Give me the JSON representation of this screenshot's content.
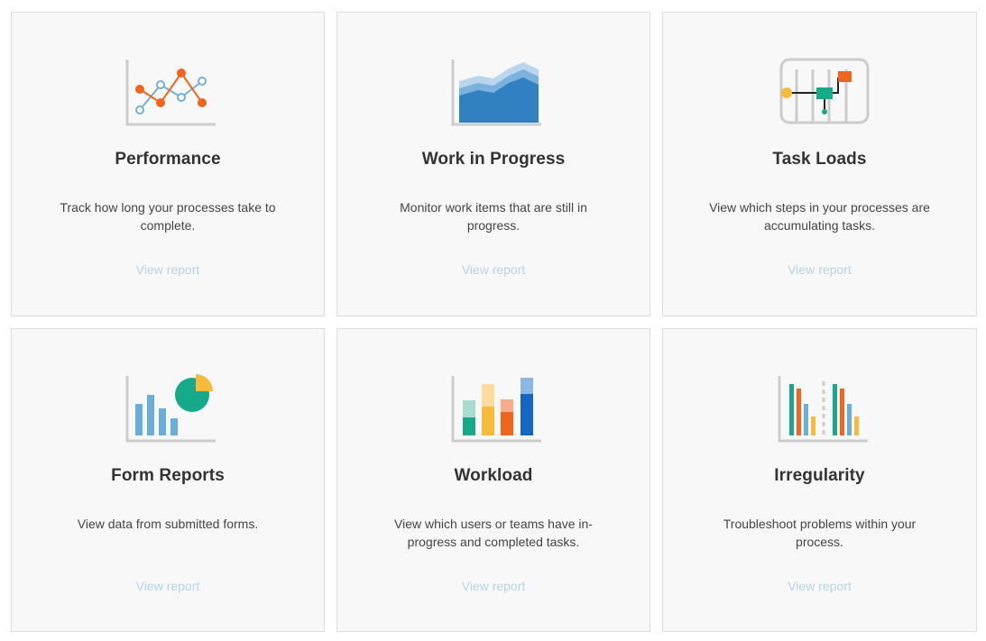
{
  "link_color": "#b7d3e9",
  "cards": [
    {
      "title": "Performance",
      "description": "Track how long your processes take to complete.",
      "link_label": "View report",
      "icon": "line-chart-icon"
    },
    {
      "title": "Work in Progress",
      "description": "Monitor work items that are still in progress.",
      "link_label": "View report",
      "icon": "area-chart-icon"
    },
    {
      "title": "Task Loads",
      "description": "View which steps in your processes are accumulating tasks.",
      "link_label": "View report",
      "icon": "flow-diagram-icon"
    },
    {
      "title": "Form Reports",
      "description": "View data from submitted forms.",
      "link_label": "View report",
      "icon": "bar-pie-chart-icon"
    },
    {
      "title": "Workload",
      "description": "View which users or teams have in-progress and completed tasks.",
      "link_label": "View report",
      "icon": "stacked-bar-chart-icon"
    },
    {
      "title": "Irregularity",
      "description": "Troubleshoot problems within your process.",
      "link_label": "View report",
      "icon": "grouped-bar-chart-icon"
    }
  ]
}
